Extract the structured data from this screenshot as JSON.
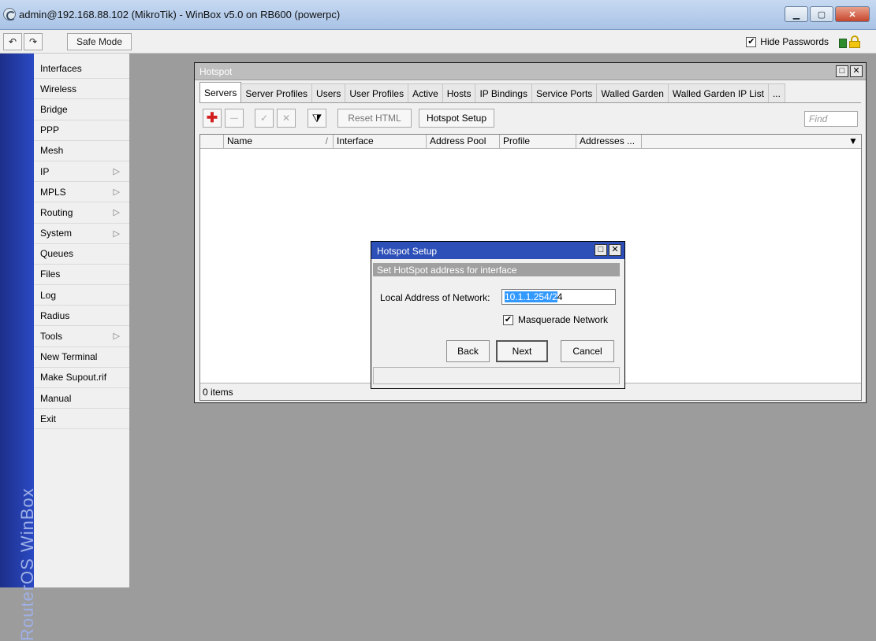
{
  "window": {
    "title": "admin@192.168.88.102 (MikroTik) - WinBox v5.0 on RB600 (powerpc)",
    "minimize": "▁",
    "maximize": "▢",
    "close": "✕"
  },
  "toolbar": {
    "undo": "↶",
    "redo": "↷",
    "safe_mode": "Safe Mode",
    "hide_passwords": "Hide Passwords",
    "hide_passwords_checked": "✔"
  },
  "sidebar": {
    "brand": "RouterOS WinBox",
    "items": [
      {
        "label": "Interfaces"
      },
      {
        "label": "Wireless"
      },
      {
        "label": "Bridge"
      },
      {
        "label": "PPP"
      },
      {
        "label": "Mesh"
      },
      {
        "label": "IP",
        "arrow": "▷"
      },
      {
        "label": "MPLS",
        "arrow": "▷"
      },
      {
        "label": "Routing",
        "arrow": "▷"
      },
      {
        "label": "System",
        "arrow": "▷"
      },
      {
        "label": "Queues"
      },
      {
        "label": "Files"
      },
      {
        "label": "Log"
      },
      {
        "label": "Radius"
      },
      {
        "label": "Tools",
        "arrow": "▷"
      },
      {
        "label": "New Terminal"
      },
      {
        "label": "Make Supout.rif"
      },
      {
        "label": "Manual"
      },
      {
        "label": "Exit"
      }
    ]
  },
  "hotspot": {
    "title": "Hotspot",
    "frame_restore": "□",
    "frame_close": "✕",
    "tabs": [
      "Servers",
      "Server Profiles",
      "Users",
      "User Profiles",
      "Active",
      "Hosts",
      "IP Bindings",
      "Service Ports",
      "Walled Garden",
      "Walled Garden IP List",
      "..."
    ],
    "active_tab": "Servers",
    "buttons": {
      "add": "✚",
      "remove": "—",
      "enable": "✓",
      "disable": "✕",
      "filter": "⧩",
      "reset_html": "Reset HTML",
      "hotspot_setup": "Hotspot Setup"
    },
    "find_placeholder": "Find",
    "columns": [
      "Name",
      "Interface",
      "Address Pool",
      "Profile",
      "Addresses ..."
    ],
    "sort_indicator": "/",
    "dropdown": "▼",
    "status": "0 items"
  },
  "dialog": {
    "title": "Hotspot Setup",
    "restore": "□",
    "close": "✕",
    "subtitle": "Set HotSpot address for interface",
    "local_address_label": "Local Address of Network:",
    "local_address_selected": "10.1.1.254/2",
    "local_address_rest": "4",
    "masquerade_label": "Masquerade Network",
    "masquerade_checked": "✔",
    "back": "Back",
    "next": "Next",
    "cancel": "Cancel"
  },
  "colors": {
    "title_bar": "#b8cfee",
    "strip": "#2a49c3",
    "dialog_title": "#2d4fb8",
    "selection": "#3399ff",
    "add_red": "#d21f1f"
  }
}
